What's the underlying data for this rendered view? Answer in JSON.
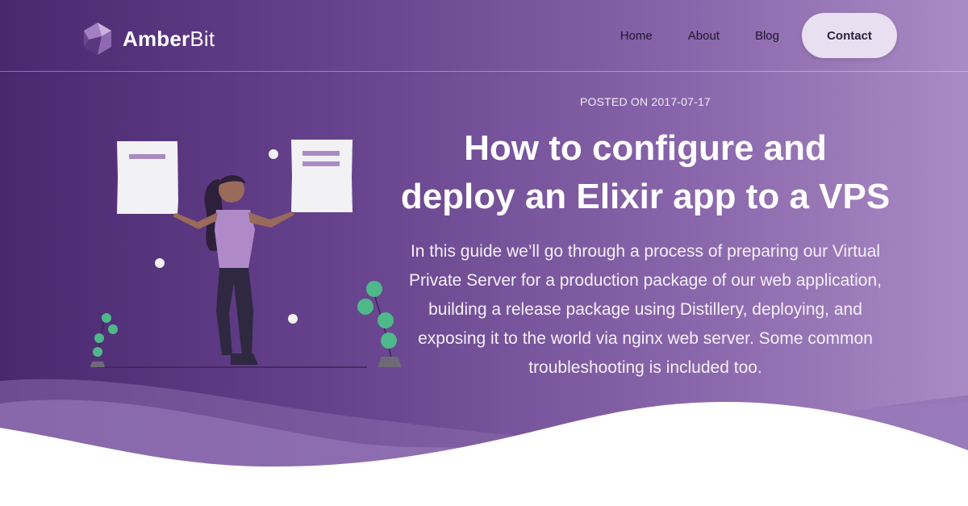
{
  "brand": {
    "name_bold": "Amber",
    "name_light": "Bit",
    "logo_icon": "geometric-gem-icon"
  },
  "nav": {
    "items": [
      "Home",
      "About",
      "Blog"
    ],
    "contact_label": "Contact"
  },
  "post": {
    "posted_label": "POSTED ON 2017-07-17",
    "title_line1": "How to configure and",
    "title_line2": "deploy an Elixir app to a VPS",
    "description": "In this guide we’ll go through a process of preparing our Virtual Private Server for a production package of our web application, building a release package using Distillery, deploying, and exposing it to the world via nginx web server. Some common troubleshooting is included too."
  },
  "colors": {
    "gradient_start": "#4a2870",
    "gradient_end": "#a98bc4",
    "contact_bg": "#e8dff0",
    "plant_green": "#4fb88a",
    "accent_lilac": "#b08ac8"
  },
  "illustration": {
    "icon": "woman-holding-documents-illustration"
  }
}
